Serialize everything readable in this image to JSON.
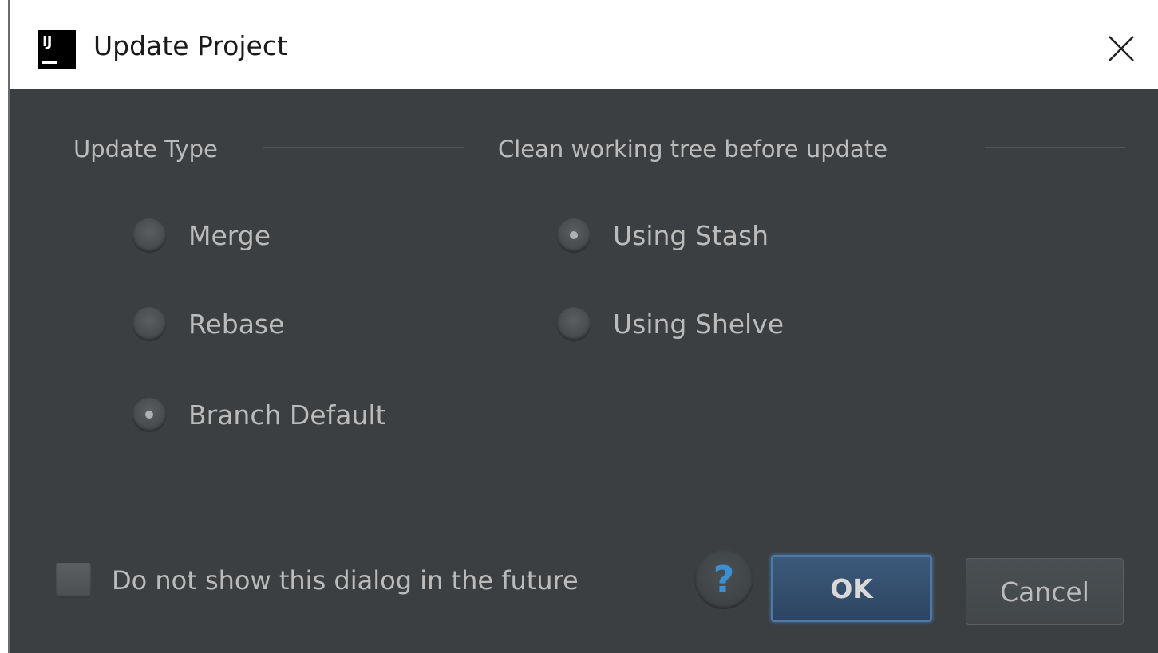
{
  "window": {
    "title": "Update Project",
    "app_icon_text": "IJ"
  },
  "update_type": {
    "label": "Update Type",
    "options": [
      {
        "label": "Merge",
        "selected": false
      },
      {
        "label": "Rebase",
        "selected": false
      },
      {
        "label": "Branch Default",
        "selected": true
      }
    ]
  },
  "clean_tree": {
    "label": "Clean working tree before update",
    "options": [
      {
        "label": "Using Stash",
        "selected": true
      },
      {
        "label": "Using Shelve",
        "selected": false
      }
    ]
  },
  "footer": {
    "dont_show_label": "Do not show this dialog in the future",
    "dont_show_checked": false,
    "help_glyph": "?",
    "ok_label": "OK",
    "cancel_label": "Cancel"
  },
  "icons": {
    "close": "close-icon",
    "help": "help-icon",
    "app": "intellij-icon"
  },
  "colors": {
    "dialog_bg": "#3c3f41",
    "titlebar_bg": "#ffffff",
    "text": "#bbbbbb",
    "ok_button": "#365880",
    "help_glyph": "#3c8fd2"
  }
}
